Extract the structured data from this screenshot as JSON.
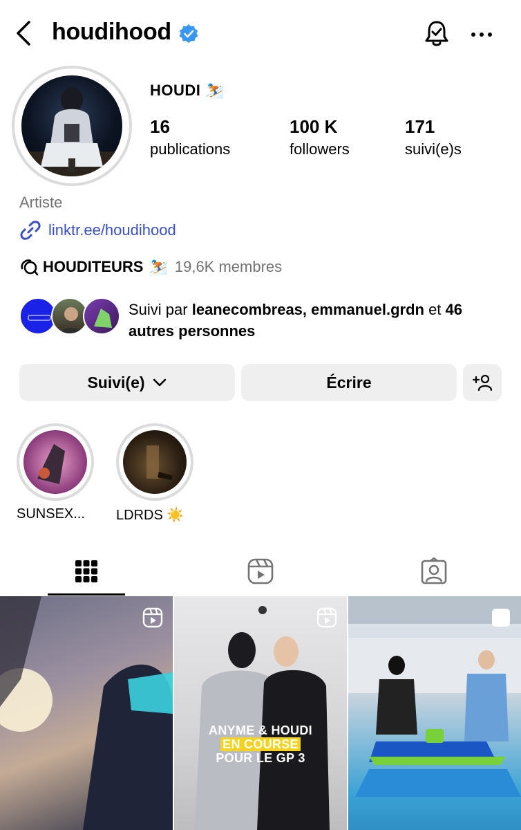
{
  "header": {
    "username": "houdihood"
  },
  "profile": {
    "display_name": "HOUDI ⛷️",
    "stats": [
      {
        "num": "16",
        "label": "publications"
      },
      {
        "num": "100 K",
        "label": "followers"
      },
      {
        "num": "171",
        "label": "suivi(e)s"
      }
    ],
    "category": "Artiste",
    "link": "linktr.ee/houdihood",
    "channel": {
      "name": "HOUDITEURS",
      "emoji": "⛷️",
      "members": "19,6K membres"
    },
    "followed_by": {
      "prefix": "Suivi par ",
      "names": "leanecombreas, emmanuel.grdn",
      "middle": " et ",
      "others": "46 autres personnes"
    }
  },
  "actions": {
    "following_label": "Suivi(e)",
    "message_label": "Écrire"
  },
  "highlights": [
    {
      "label": "SUNSEX..."
    },
    {
      "label": "LDRDS ☀️"
    }
  ],
  "tabs": [
    "grid-icon",
    "reels-icon",
    "tagged-icon"
  ],
  "grid": {
    "post2_caption": {
      "line1": "ANYME & HOUDI",
      "line2": "EN COURSE",
      "line3": "POUR LE GP 3"
    }
  },
  "colors": {
    "link": "#3a4fc5",
    "verified": "#3897f0",
    "muted": "#737373",
    "button_bg": "#efefef"
  }
}
